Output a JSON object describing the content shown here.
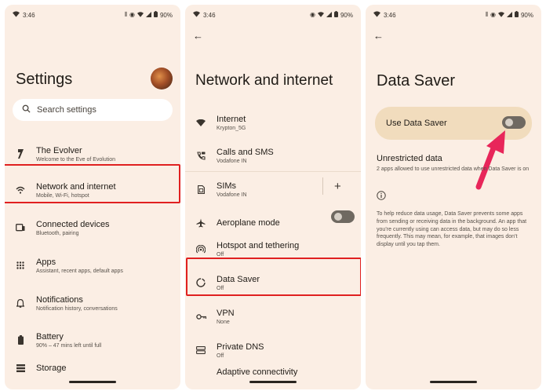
{
  "colors": {
    "panel_bg": "#fbeee4",
    "highlight": "#e02020",
    "card": "#f1dcbd",
    "toggle": "#6f6961",
    "arrow": "#e8265a"
  },
  "panel1": {
    "status": {
      "time": "3:46",
      "battery": "90%"
    },
    "title": "Settings",
    "search_placeholder": "Search settings",
    "items": [
      {
        "icon": "evolver-icon",
        "title": "The Evolver",
        "subtitle": "Welcome to the Eve of Evolution"
      },
      {
        "icon": "wifi-icon",
        "title": "Network and internet",
        "subtitle": "Mobile, Wi-Fi, hotspot"
      },
      {
        "icon": "devices-icon",
        "title": "Connected devices",
        "subtitle": "Bluetooth, pairing"
      },
      {
        "icon": "apps-icon",
        "title": "Apps",
        "subtitle": "Assistant, recent apps, default apps"
      },
      {
        "icon": "bell-icon",
        "title": "Notifications",
        "subtitle": "Notification history, conversations"
      },
      {
        "icon": "battery-icon",
        "title": "Battery",
        "subtitle": "90% – 47 mins left until full"
      },
      {
        "icon": "storage-icon",
        "title": "Storage",
        "subtitle": ""
      }
    ]
  },
  "panel2": {
    "status": {
      "time": "3:46",
      "battery": "90%"
    },
    "title": "Network and internet",
    "items": [
      {
        "icon": "wifi-icon",
        "title": "Internet",
        "subtitle": "Krypton_5G"
      },
      {
        "icon": "calls-icon",
        "title": "Calls and SMS",
        "subtitle": "Vodafone IN"
      },
      {
        "icon": "sim-icon",
        "title": "SIMs",
        "subtitle": "Vodafone IN"
      },
      {
        "icon": "airplane-icon",
        "title": "Aeroplane mode",
        "subtitle": ""
      },
      {
        "icon": "hotspot-icon",
        "title": "Hotspot and tethering",
        "subtitle": "Off"
      },
      {
        "icon": "data-saver-icon",
        "title": "Data Saver",
        "subtitle": "Off"
      },
      {
        "icon": "vpn-icon",
        "title": "VPN",
        "subtitle": "None"
      },
      {
        "icon": "dns-icon",
        "title": "Private DNS",
        "subtitle": "Off"
      },
      {
        "icon": "adaptive-icon",
        "title": "Adaptive connectivity",
        "subtitle": ""
      }
    ],
    "plus": "+"
  },
  "panel3": {
    "status": {
      "time": "3:46",
      "battery": "90%"
    },
    "title": "Data Saver",
    "toggle_label": "Use Data Saver",
    "unrestricted_title": "Unrestricted data",
    "unrestricted_sub": "2 apps allowed to use unrestricted data when Data Saver is on",
    "info_text": "To help reduce data usage, Data Saver prevents some apps from sending or receiving data in the background. An app that you’re currently using can access data, but may do so less frequently. This may mean, for example, that images don’t display until you tap them."
  }
}
